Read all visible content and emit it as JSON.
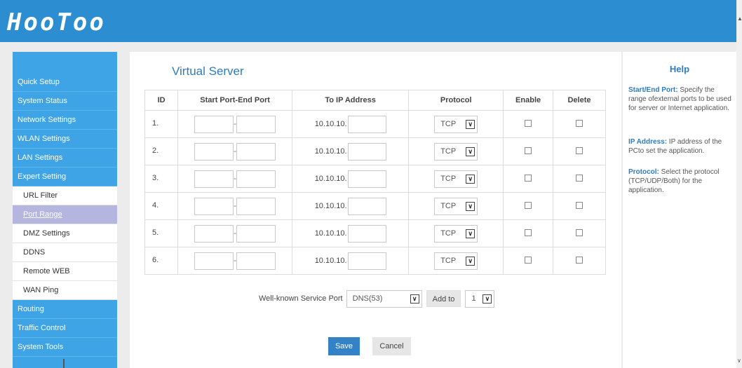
{
  "brand": {
    "logo": "HooToo",
    "header_color": "#2c8ed0"
  },
  "sidebar": {
    "items": [
      {
        "label": "Quick Setup"
      },
      {
        "label": "System Status"
      },
      {
        "label": "Network Settings"
      },
      {
        "label": "WLAN Settings"
      },
      {
        "label": "LAN Settings"
      },
      {
        "label": "Expert Setting"
      }
    ],
    "subitems": [
      {
        "label": "URL Filter"
      },
      {
        "label": "Port Range"
      },
      {
        "label": "DMZ Settings"
      },
      {
        "label": "DDNS"
      },
      {
        "label": "Remote WEB"
      },
      {
        "label": "WAN Ping"
      }
    ],
    "items_after": [
      {
        "label": "Routing"
      },
      {
        "label": "Traffic Control"
      },
      {
        "label": "System Tools"
      }
    ],
    "active_subitem": "Port Range"
  },
  "main": {
    "title": "Virtual Server",
    "table": {
      "headers": {
        "id": "ID",
        "ports": "Start Port-End Port",
        "ip": "To IP Address",
        "protocol": "Protocol",
        "enable": "Enable",
        "delete": "Delete"
      },
      "rows": [
        {
          "id": "1.",
          "ip_prefix": "10.10.10.",
          "protocol": "TCP"
        },
        {
          "id": "2.",
          "ip_prefix": "10.10.10.",
          "protocol": "TCP"
        },
        {
          "id": "3.",
          "ip_prefix": "10.10.10.",
          "protocol": "TCP"
        },
        {
          "id": "4.",
          "ip_prefix": "10.10.10.",
          "protocol": "TCP"
        },
        {
          "id": "5.",
          "ip_prefix": "10.10.10.",
          "protocol": "TCP"
        },
        {
          "id": "6.",
          "ip_prefix": "10.10.10.",
          "protocol": "TCP"
        }
      ]
    },
    "well_known": {
      "label": "Well-known Service Port",
      "selected": "DNS(53)",
      "add_to_label": "Add to",
      "row_selected": "1"
    },
    "save_label": "Save",
    "cancel_label": "Cancel"
  },
  "help": {
    "title": "Help",
    "sections": [
      {
        "keyword": "Start/End Port:",
        "text": " Specify the range ofexternal ports to be used for server or Internet application."
      },
      {
        "keyword": "IP Address:",
        "text": " IP address of the PCto set the application."
      },
      {
        "keyword": "Protocol:",
        "text": " Select the protocol (TCP/UDP/Both) for the application."
      }
    ]
  },
  "colors": {
    "accent": "#2e7bbf",
    "sidebar": "#3ea4e6",
    "active_sub": "#b4b6e0",
    "save": "#3382c8"
  }
}
